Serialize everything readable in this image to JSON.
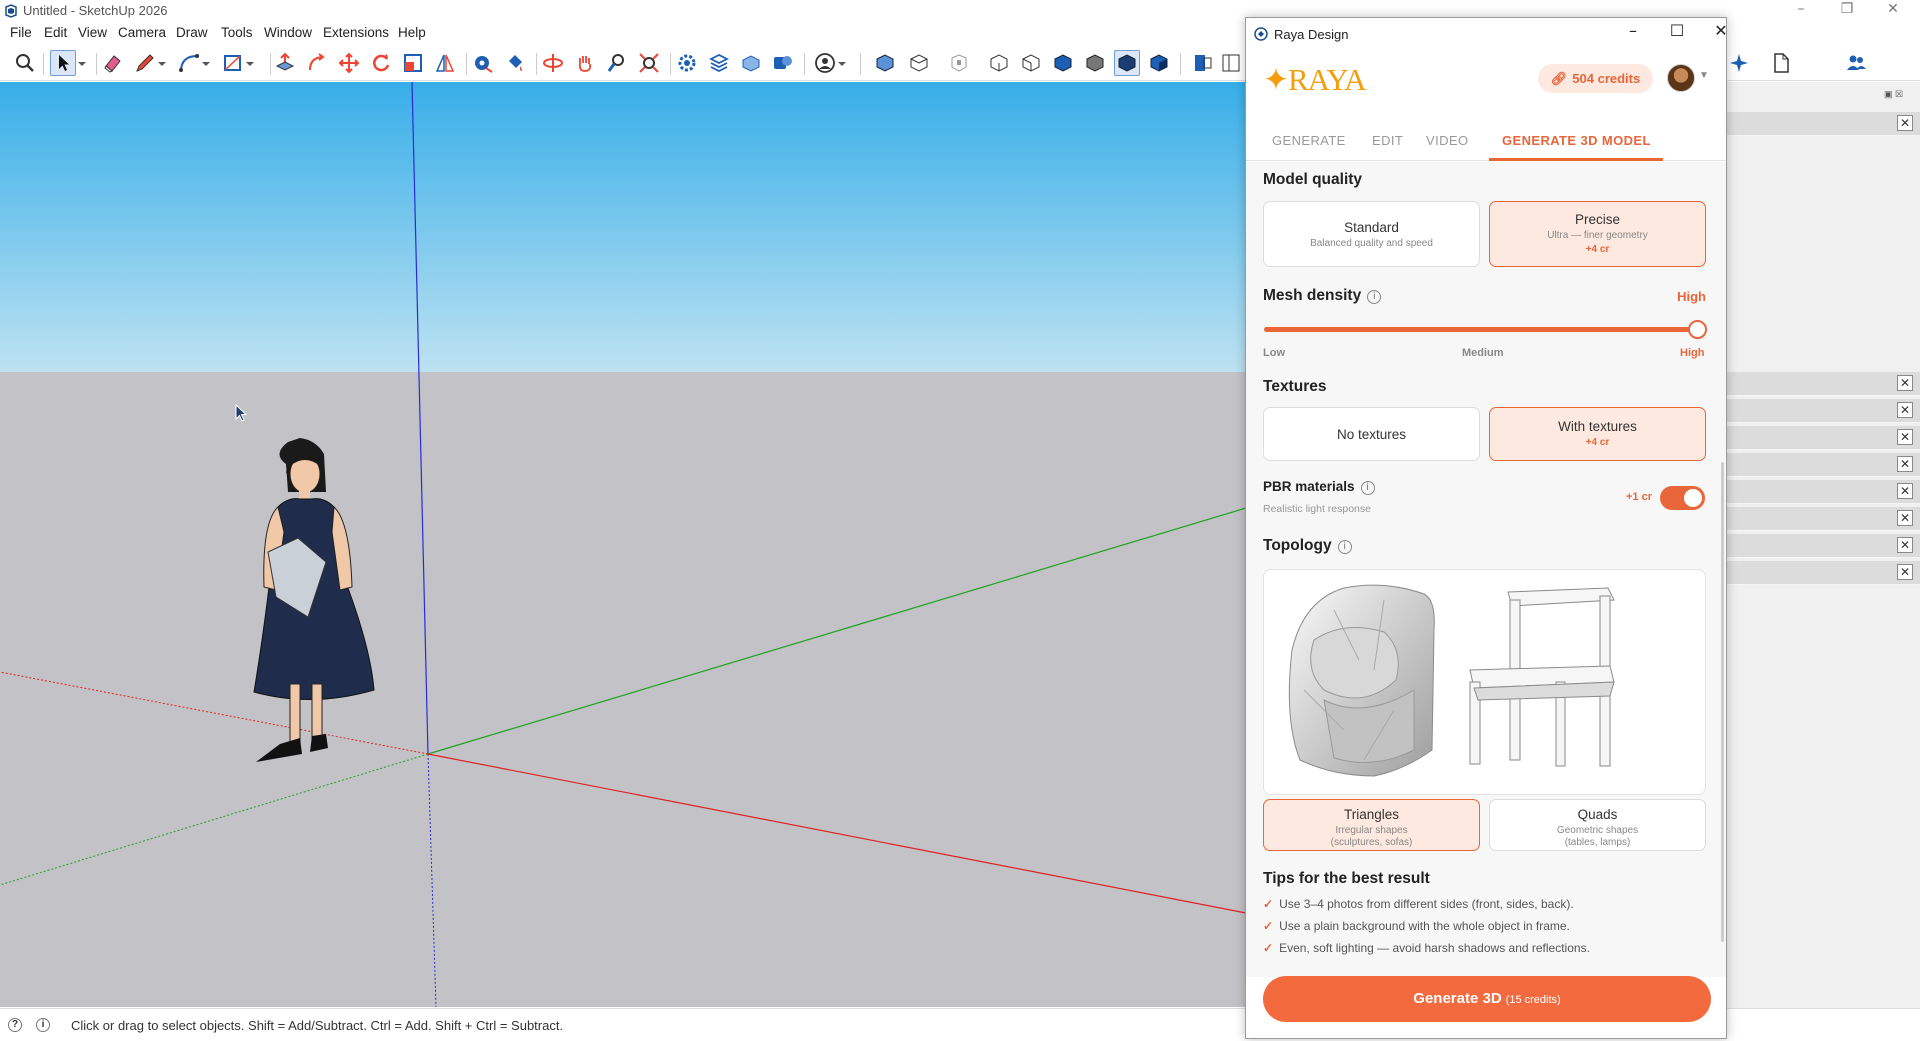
{
  "window": {
    "title": "Untitled - SketchUp 2026"
  },
  "menu": [
    "File",
    "Edit",
    "View",
    "Camera",
    "Draw",
    "Tools",
    "Window",
    "Extensions",
    "Help"
  ],
  "status": {
    "message": "Click or drag to select objects. Shift = Add/Subtract. Ctrl = Add. Shift + Ctrl = Subtract."
  },
  "colors": {
    "accent": "#e8663a",
    "accent_bg": "#fde9df",
    "brand": "#f59e0b",
    "sky_top": "#37aee9",
    "ground": "#c3c3c7"
  },
  "dialog": {
    "title": "Raya Design",
    "brand": "RAYA",
    "credits": "504 credits",
    "tabs": [
      "GENERATE",
      "EDIT",
      "VIDEO",
      "GENERATE 3D MODEL"
    ],
    "active_tab": "GENERATE 3D MODEL",
    "model_quality": {
      "label": "Model quality",
      "options": [
        {
          "label": "Standard",
          "sub": "Balanced quality and speed",
          "cost": ""
        },
        {
          "label": "Precise",
          "sub": "Ultra — finer geometry",
          "cost": "+4 cr"
        }
      ],
      "selected": "Precise"
    },
    "mesh_density": {
      "label": "Mesh density",
      "value": "High",
      "level": 1.0,
      "ticks": [
        "Low",
        "Medium",
        "High"
      ]
    },
    "textures": {
      "label": "Textures",
      "options": [
        {
          "label": "No textures",
          "cost": ""
        },
        {
          "label": "With textures",
          "cost": "+4 cr"
        }
      ],
      "selected": "With textures"
    },
    "pbr": {
      "label": "PBR materials",
      "sub": "Realistic light response",
      "cost": "+1 cr",
      "enabled": true
    },
    "topology": {
      "label": "Topology",
      "options": [
        {
          "label": "Triangles",
          "sub1": "Irregular shapes",
          "sub2": "(sculptures, sofas)"
        },
        {
          "label": "Quads",
          "sub1": "Geometric shapes",
          "sub2": "(tables, lamps)"
        }
      ],
      "selected": "Triangles"
    },
    "tips": {
      "title": "Tips for the best result",
      "items": [
        "Use 3–4 photos from different sides (front, sides, back).",
        "Use a plain background with the whole object in frame.",
        "Even, soft lighting — avoid harsh shadows and reflections."
      ]
    },
    "generate_button": {
      "label": "Generate 3D",
      "credits": "(15 credits)"
    }
  }
}
